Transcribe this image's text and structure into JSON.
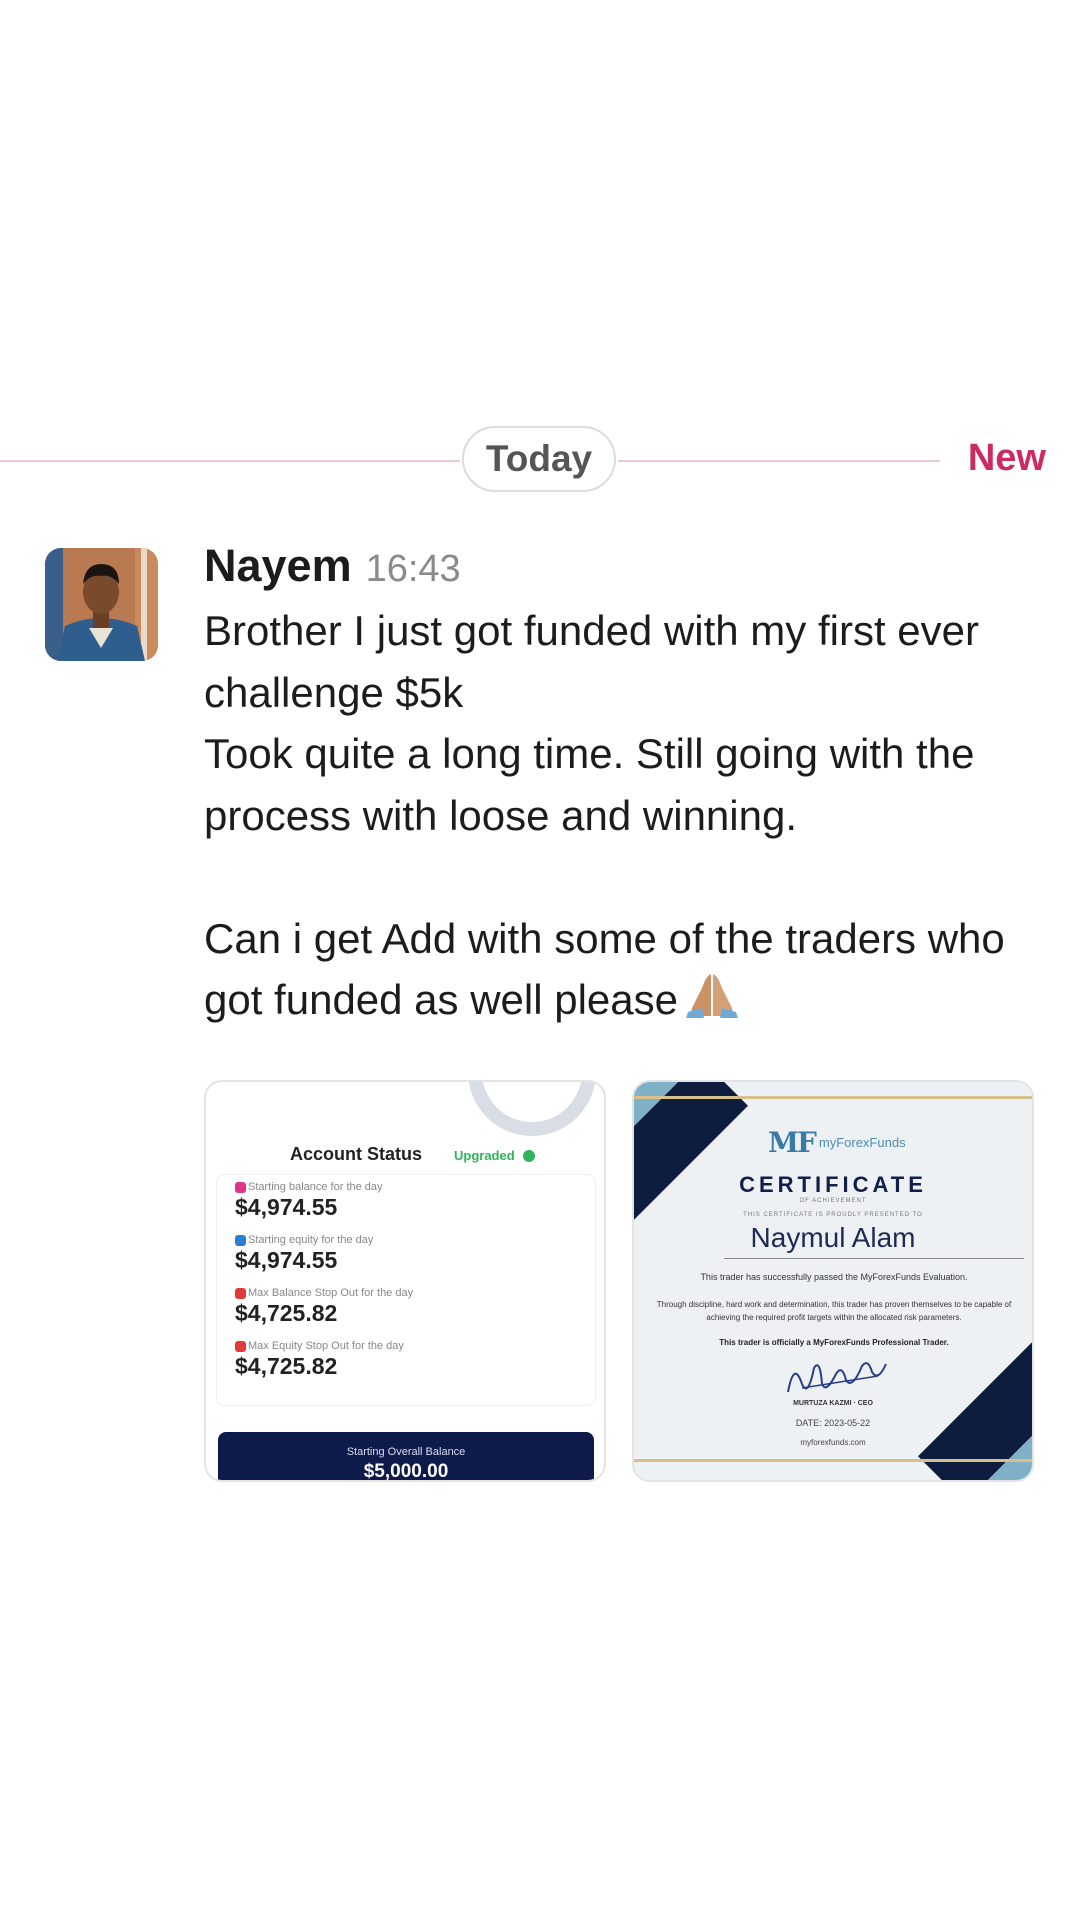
{
  "divider": {
    "today_label": "Today",
    "new_label": "New"
  },
  "message": {
    "author": "Nayem",
    "time": "16:43",
    "lines": [
      "Brother I just got funded with my first ever challenge $5k",
      "Took quite a long time. Still going with the process with loose and winning.",
      "Can i get Add with some of the traders who got funded as well please"
    ],
    "emoji_icon": "folded-hands-icon"
  },
  "attachments": {
    "account_status": {
      "title": "Account Status",
      "badge": "Upgraded",
      "stats": [
        {
          "label": "Starting balance for the day",
          "value": "$4,974.55",
          "color": "#e0348a"
        },
        {
          "label": "Starting equity for the day",
          "value": "$4,974.55",
          "color": "#2a7fd6"
        },
        {
          "label": "Max Balance Stop Out for the day",
          "value": "$4,725.82",
          "color": "#e03a3a"
        },
        {
          "label": "Max Equity Stop Out for the day",
          "value": "$4,725.82",
          "color": "#e03a3a"
        }
      ],
      "overall_label": "Starting Overall Balance",
      "overall_value": "$5,000.00"
    },
    "certificate": {
      "logo_mark": "MF",
      "brand": "myForexFunds",
      "title": "CERTIFICATE",
      "subtitle": "OF ACHIEVEMENT",
      "presented": "THIS CERTIFICATE IS PROUDLY PRESENTED TO",
      "name": "Naymul Alam",
      "line1": "This trader has successfully passed the MyForexFunds Evaluation.",
      "line2": "Through discipline, hard work and determination, this trader has proven themselves to be capable of achieving the required profit targets within the allocated risk parameters.",
      "line3": "This trader is officially a MyForexFunds Professional Trader.",
      "signer": "MURTUZA KAZMI · CEO",
      "date": "DATE: 2023-05-22",
      "url": "myforexfunds.com"
    }
  }
}
